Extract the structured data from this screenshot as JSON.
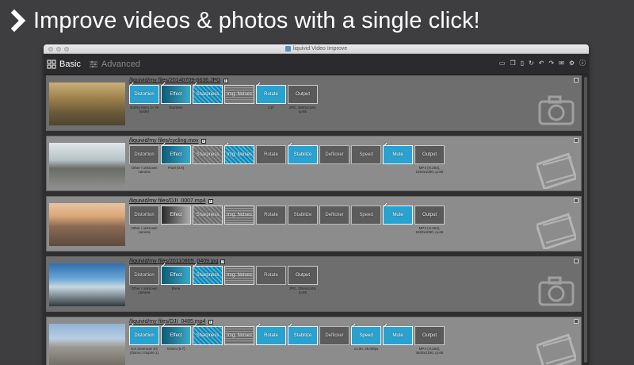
{
  "headline": "Improve videos & photos with a single click!",
  "window": {
    "title": "liquivid Video Improve"
  },
  "tabs": {
    "basic": "Basic",
    "advanced": "Advanced"
  },
  "toolbar_icons": [
    "folder-icon",
    "copy-icon",
    "paste-icon",
    "refresh-icon",
    "undo-icon",
    "redo-icon",
    "mail-icon",
    "settings-icon",
    "info-icon"
  ],
  "rows": [
    {
      "file": "/liquivid/my files/20140709-6636.JPG",
      "kind": "photo",
      "steps": [
        {
          "label": "Distortion",
          "state": "on",
          "style": "on",
          "sub": "GoPro Hero 3+ W\n(wide)"
        },
        {
          "label": "Effect",
          "state": "on",
          "style": "eff-on",
          "sub": "Summer"
        },
        {
          "label": "Sharpness",
          "state": "on",
          "style": "tex-on",
          "sub": ""
        },
        {
          "label": "Img. Noises",
          "state": "off",
          "style": "noise",
          "sub": ""
        },
        {
          "label": "Rotate",
          "state": "on",
          "style": "on",
          "sub": "1.0°"
        },
        {
          "label": "Output",
          "state": "off",
          "style": "out",
          "sub": "JPG, 3600x2160,\nq=85"
        }
      ]
    },
    {
      "file": "/liquivid/my files/cycling.mov",
      "kind": "video",
      "steps": [
        {
          "label": "Distortion",
          "state": "off",
          "style": "off",
          "sub": "Other / unknown\ncamera"
        },
        {
          "label": "Effect",
          "state": "on",
          "style": "eff-on",
          "sub": "Pixel (0.5)"
        },
        {
          "label": "Sharpness",
          "state": "off",
          "style": "tex-off",
          "sub": ""
        },
        {
          "label": "Img. Noises",
          "state": "on",
          "style": "tex-on",
          "sub": ""
        },
        {
          "label": "Rotate",
          "state": "off",
          "style": "off",
          "sub": ""
        },
        {
          "label": "Stabilize",
          "state": "on",
          "style": "on",
          "sub": ""
        },
        {
          "label": "Deflicker",
          "state": "off",
          "style": "off",
          "sub": ""
        },
        {
          "label": "Speed",
          "state": "off",
          "style": "off",
          "sub": ""
        },
        {
          "label": "Mute",
          "state": "on",
          "style": "on",
          "sub": ""
        },
        {
          "label": "Output",
          "state": "off",
          "style": "out",
          "sub": "MP4 (H.264),\n1920x1080, q=66"
        }
      ]
    },
    {
      "file": "/liquivid/my files/DJI_0007.mp4",
      "kind": "video",
      "steps": [
        {
          "label": "Distortion",
          "state": "off",
          "style": "off",
          "sub": "Other / unknown\ncamera"
        },
        {
          "label": "Effect",
          "state": "off",
          "style": "eff-off",
          "sub": ""
        },
        {
          "label": "Sharpness",
          "state": "off",
          "style": "tex-off",
          "sub": ""
        },
        {
          "label": "Img. Noises",
          "state": "off",
          "style": "noise",
          "sub": ""
        },
        {
          "label": "Rotate",
          "state": "off",
          "style": "off",
          "sub": ""
        },
        {
          "label": "Stabilize",
          "state": "off",
          "style": "off",
          "sub": ""
        },
        {
          "label": "Deflicker",
          "state": "off",
          "style": "off",
          "sub": ""
        },
        {
          "label": "Speed",
          "state": "off",
          "style": "off",
          "sub": ""
        },
        {
          "label": "Mute",
          "state": "on",
          "style": "on",
          "sub": ""
        },
        {
          "label": "Output",
          "state": "off",
          "style": "out",
          "sub": "MP4 (H.264),\n1920x1080, q=66"
        }
      ]
    },
    {
      "file": "/liquivid/my files/20110805_0409.jpg",
      "kind": "photo",
      "steps": [
        {
          "label": "Distortion",
          "state": "off",
          "style": "off",
          "sub": "Other / unknown\ncamera"
        },
        {
          "label": "Effect",
          "state": "on",
          "style": "eff-on",
          "sub": "Bone"
        },
        {
          "label": "Sharpness",
          "state": "on",
          "style": "tex-on",
          "sub": ""
        },
        {
          "label": "Img. Noises",
          "state": "off",
          "style": "noise",
          "sub": ""
        },
        {
          "label": "Rotate",
          "state": "off",
          "style": "off",
          "sub": ""
        },
        {
          "label": "Output",
          "state": "off",
          "style": "out",
          "sub": "JPG, 3264x2448,\nq=85"
        }
      ]
    },
    {
      "file": "/liquivid/my files/DJI_0485.mp4",
      "kind": "video",
      "steps": [
        {
          "label": "Distortion",
          "state": "on",
          "style": "on",
          "sub": "DJI Zenmuse X3\n(Osmo / Inspire 1)"
        },
        {
          "label": "Effect",
          "state": "on",
          "style": "eff-on",
          "sub": "Green (0.7)"
        },
        {
          "label": "Sharpness",
          "state": "on",
          "style": "tex-on",
          "sub": ""
        },
        {
          "label": "Img. Noises",
          "state": "off",
          "style": "noise",
          "sub": ""
        },
        {
          "label": "Rotate",
          "state": "on",
          "style": "on",
          "sub": ""
        },
        {
          "label": "Stabilize",
          "state": "on",
          "style": "on",
          "sub": ""
        },
        {
          "label": "Deflicker",
          "state": "off",
          "style": "off",
          "sub": ""
        },
        {
          "label": "Speed",
          "state": "on",
          "style": "on",
          "sub": "x1.00, 25.00fps"
        },
        {
          "label": "Mute",
          "state": "on",
          "style": "on",
          "sub": ""
        },
        {
          "label": "Output",
          "state": "off",
          "style": "out",
          "sub": "MP4 (H.264),\n3840x2160, q=66"
        }
      ]
    }
  ]
}
